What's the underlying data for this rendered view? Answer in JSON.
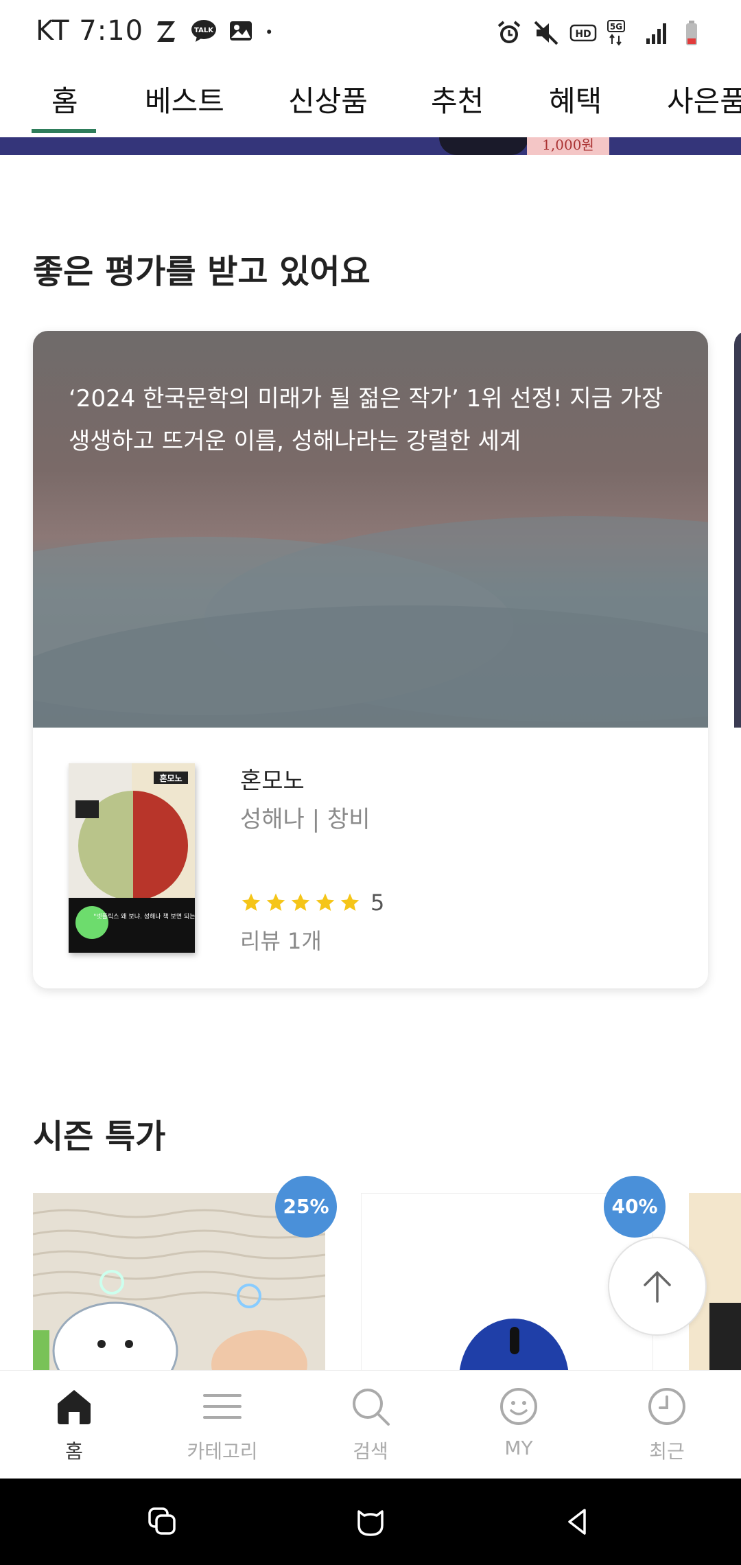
{
  "status_bar": {
    "carrier_time": "KT 7:10",
    "left_icons": [
      "z-app-icon",
      "talk-icon",
      "gallery-icon",
      "dot-icon"
    ],
    "talk_label": "TALK",
    "right_icons": [
      "alarm-icon",
      "mute-icon",
      "hd-icon",
      "5g-icon",
      "signal-icon",
      "battery-icon"
    ],
    "hd_label": "HD",
    "fiveg_label": "5G"
  },
  "tabs": [
    {
      "label": "홈",
      "active": true
    },
    {
      "label": "베스트"
    },
    {
      "label": "신상품"
    },
    {
      "label": "추천"
    },
    {
      "label": "혜택"
    },
    {
      "label": "사은품"
    }
  ],
  "banner": {
    "price_text": "1,000원"
  },
  "review_section": {
    "title": "좋은 평가를 받고 있어요",
    "card": {
      "hero_text": "‘2024 한국문학의 미래가 될 젊은 작가’ 1위 선정! 지금 가장 생생하고 뜨거운 이름, 성해나라는 강렬한 세계",
      "book_cover_title": "혼모노",
      "book_cover_quote": "\"넷플릭스 왜 보냐. 성해나 책 보면 되는데.\"",
      "book_title": "혼모노",
      "book_meta": "성해나 | 창비",
      "rating": "5",
      "rating_stars": 5,
      "review_count": "리뷰 1개"
    }
  },
  "season_section": {
    "title": "시즌 특가",
    "items": [
      {
        "discount": "25%"
      },
      {
        "discount": "40%"
      }
    ]
  },
  "bottom_nav": [
    {
      "label": "홈",
      "icon": "home-icon",
      "active": true
    },
    {
      "label": "카테고리",
      "icon": "menu-icon"
    },
    {
      "label": "검색",
      "icon": "search-icon"
    },
    {
      "label": "MY",
      "icon": "smile-icon"
    },
    {
      "label": "최근",
      "icon": "clock-icon"
    }
  ],
  "colors": {
    "tab_underline": "#2e7d5b",
    "badge": "#4a90d9",
    "star": "#f5c518"
  }
}
